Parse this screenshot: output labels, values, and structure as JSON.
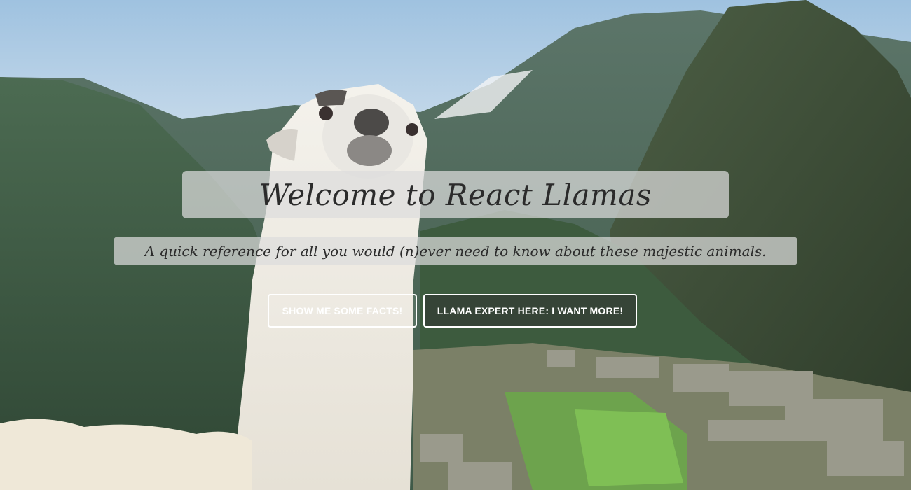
{
  "hero": {
    "title": "Welcome to React Llamas",
    "subtitle": "A quick reference for all you would (n)ever need to know about these majestic animals.",
    "buttons": {
      "facts_label": "SHOW ME SOME FACTS!",
      "expert_label": "LLAMA EXPERT HERE: I WANT MORE!"
    }
  },
  "colors": {
    "overlay_box": "#dcdcdc",
    "title_text": "#2b2b2b",
    "button_border": "#ffffff",
    "button_text": "#ffffff"
  },
  "icons": {
    "background": "llama-machu-picchu-photo"
  }
}
